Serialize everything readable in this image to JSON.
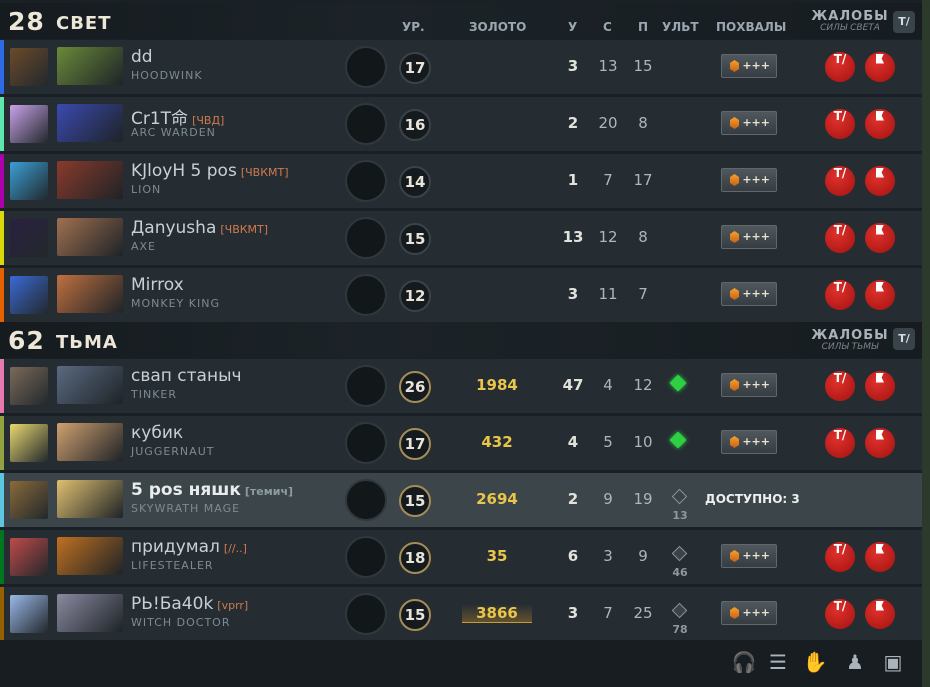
{
  "radiant": {
    "score": "28",
    "name": "СВЕТ",
    "reports_title": "ЖАЛОБЫ",
    "reports_sub": "СИЛЫ СВЕТА",
    "mute_all": "T/"
  },
  "dire": {
    "score": "62",
    "name": "ТЬМА",
    "reports_title": "ЖАЛОБЫ",
    "reports_sub": "СИЛЫ ТЬМЫ",
    "mute_all": "T/"
  },
  "columns": {
    "level": "УР.",
    "gold": "ЗОЛОТО",
    "kills": "У",
    "deaths": "С",
    "assists": "П",
    "ult": "УЛЬТ",
    "praise": "ПОХВАЛЫ"
  },
  "praise_label": "+++",
  "mute_label": "T/",
  "available_label": "ДОСТУПНО: 3",
  "players": [
    {
      "color": "#2e6ae6",
      "name": "dd",
      "tag": "",
      "hero": "HOODWINK",
      "level": "17",
      "gold": "",
      "k": "3",
      "d": "13",
      "a": "15",
      "ult": "",
      "ult_cd": ""
    },
    {
      "color": "#5de6ad",
      "name": "Cr1T命",
      "tag": "[ЧВД]",
      "hero": "ARC WARDEN",
      "level": "16",
      "gold": "",
      "k": "2",
      "d": "20",
      "a": "8",
      "ult": "",
      "ult_cd": ""
    },
    {
      "color": "#ad00ad",
      "name": "KJloyH 5 pos",
      "tag": "[ЧВКМТ]",
      "hero": "LION",
      "level": "14",
      "gold": "",
      "k": "1",
      "d": "7",
      "a": "17",
      "ult": "",
      "ult_cd": ""
    },
    {
      "color": "#dcd90a",
      "name": "Дanyusha",
      "tag": "[ЧВКМТ]",
      "hero": "AXE",
      "level": "15",
      "gold": "",
      "k": "13",
      "d": "12",
      "a": "8",
      "ult": "",
      "ult_cd": ""
    },
    {
      "color": "#e66200",
      "name": "Mirrox",
      "tag": "",
      "hero": "MONKEY KING",
      "level": "12",
      "gold": "",
      "k": "3",
      "d": "11",
      "a": "7",
      "ult": "",
      "ult_cd": ""
    },
    {
      "color": "#e67ab0",
      "name": "свап станыч",
      "tag": "",
      "hero": "TINKER",
      "level": "26",
      "gold": "1984",
      "k": "47",
      "d": "4",
      "a": "12",
      "ult": "ready",
      "ult_cd": ""
    },
    {
      "color": "#92a440",
      "name": "кубик",
      "tag": "",
      "hero": "JUGGERNAUT",
      "level": "17",
      "gold": "432",
      "k": "4",
      "d": "5",
      "a": "10",
      "ult": "ready",
      "ult_cd": ""
    },
    {
      "color": "#5cc5e0",
      "name": "5 pos няшк",
      "tag": "[темич]",
      "hero": "SKYWRATH MAGE",
      "level": "15",
      "gold": "2694",
      "k": "2",
      "d": "9",
      "a": "19",
      "ult": "cooldown",
      "ult_cd": "13"
    },
    {
      "color": "#00771f",
      "name": "придумал",
      "tag": "[//..]",
      "hero": "LIFESTEALER",
      "level": "18",
      "gold": "35",
      "k": "6",
      "d": "3",
      "a": "9",
      "ult": "cooldown",
      "ult_cd": "46"
    },
    {
      "color": "#956000",
      "name": "PЬ!Бa40k",
      "tag": "[vprr]",
      "hero": "WITCH DOCTOR",
      "level": "15",
      "gold": "3866",
      "k": "3",
      "d": "7",
      "a": "25",
      "ult": "cooldown",
      "ult_cd": "78"
    }
  ],
  "bottom_icons": [
    "headset-icon",
    "scoreboard-list-icon",
    "hand-share-icon",
    "unit-control-icon",
    "stash-icon"
  ]
}
